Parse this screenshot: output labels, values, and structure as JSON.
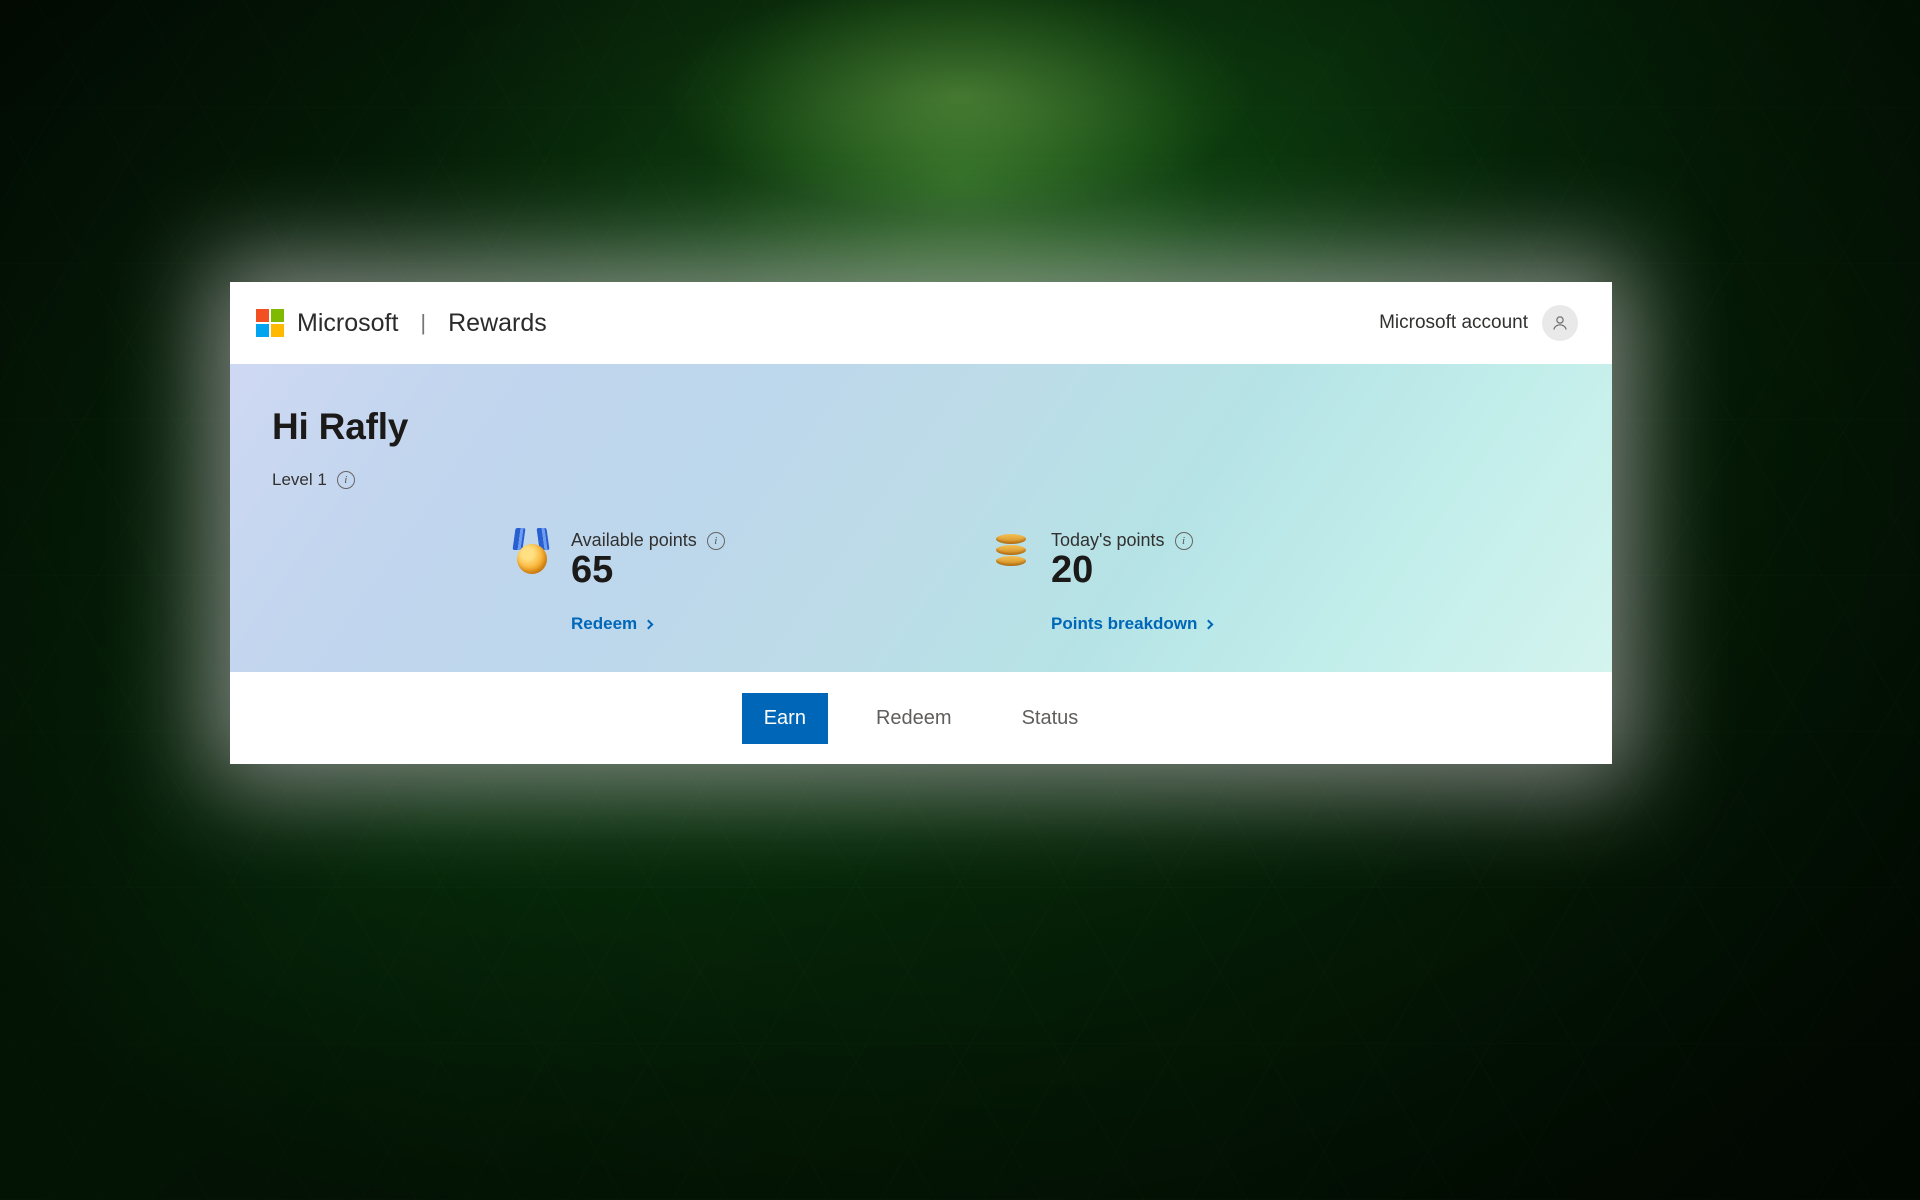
{
  "header": {
    "brand": "Microsoft",
    "divider": "|",
    "product": "Rewards",
    "account_label": "Microsoft account"
  },
  "hero": {
    "greeting": "Hi Rafly",
    "level_text": "Level 1",
    "stats": {
      "available": {
        "label": "Available points",
        "value": "65",
        "link_text": "Redeem"
      },
      "today": {
        "label": "Today's points",
        "value": "20",
        "link_text": "Points breakdown"
      }
    }
  },
  "tabs": {
    "earn": "Earn",
    "redeem": "Redeem",
    "status": "Status"
  }
}
